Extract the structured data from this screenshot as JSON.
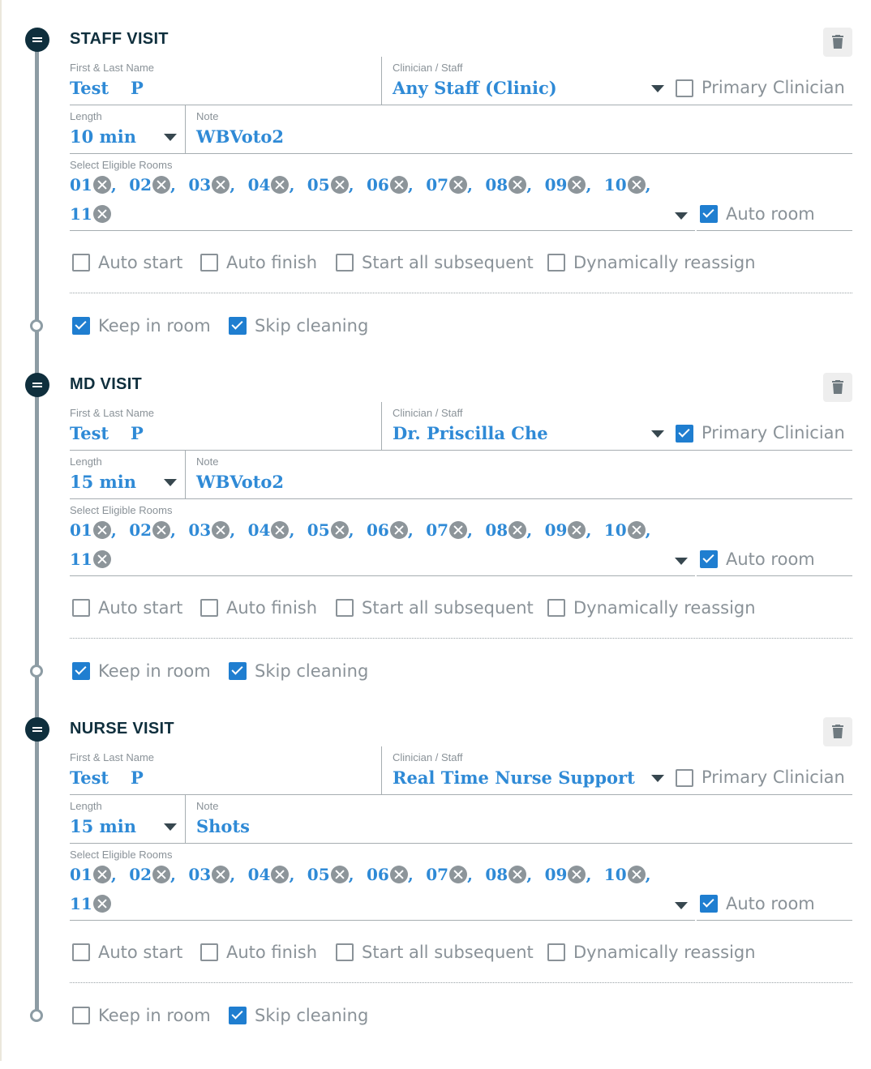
{
  "labels": {
    "name": "First & Last Name",
    "clinician": "Clinician / Staff",
    "length": "Length",
    "note": "Note",
    "rooms": "Select Eligible Rooms",
    "primary": "Primary Clinician",
    "auto_room": "Auto room",
    "auto_start": "Auto start",
    "auto_finish": "Auto finish",
    "start_subsequent": "Start all subsequent",
    "dyn_reassign": "Dynamically reassign",
    "keep_room": "Keep in room",
    "skip_cleaning": "Skip cleaning"
  },
  "rooms": [
    "01",
    "02",
    "03",
    "04",
    "05",
    "06",
    "07",
    "08",
    "09",
    "10",
    "11"
  ],
  "visits": [
    {
      "title": "STAFF VISIT",
      "first": "Test",
      "last": "P",
      "clinician": "Any Staff (Clinic)",
      "length": "10 min",
      "note": "WBVoto2",
      "primary": false,
      "auto_room": true,
      "auto_start": false,
      "auto_finish": false,
      "start_subsequent": false,
      "dyn_reassign": false,
      "keep_room": true,
      "skip_cleaning": true
    },
    {
      "title": "MD VISIT",
      "first": "Test",
      "last": "P",
      "clinician": "Dr. Priscilla Che",
      "length": "15 min",
      "note": "WBVoto2",
      "primary": true,
      "auto_room": true,
      "auto_start": false,
      "auto_finish": false,
      "start_subsequent": false,
      "dyn_reassign": false,
      "keep_room": true,
      "skip_cleaning": true
    },
    {
      "title": "NURSE VISIT",
      "first": "Test",
      "last": "P",
      "clinician": "Real Time Nurse Support",
      "length": "15 min",
      "note": "Shots",
      "primary": false,
      "auto_room": true,
      "auto_start": false,
      "auto_finish": false,
      "start_subsequent": false,
      "dyn_reassign": false,
      "keep_room": false,
      "skip_cleaning": true
    }
  ],
  "colors": {
    "accent": "#2f8ad6",
    "checkbox": "#1f7ed0",
    "heading": "#0f2f3d",
    "timeline": "#8d9ca4"
  }
}
